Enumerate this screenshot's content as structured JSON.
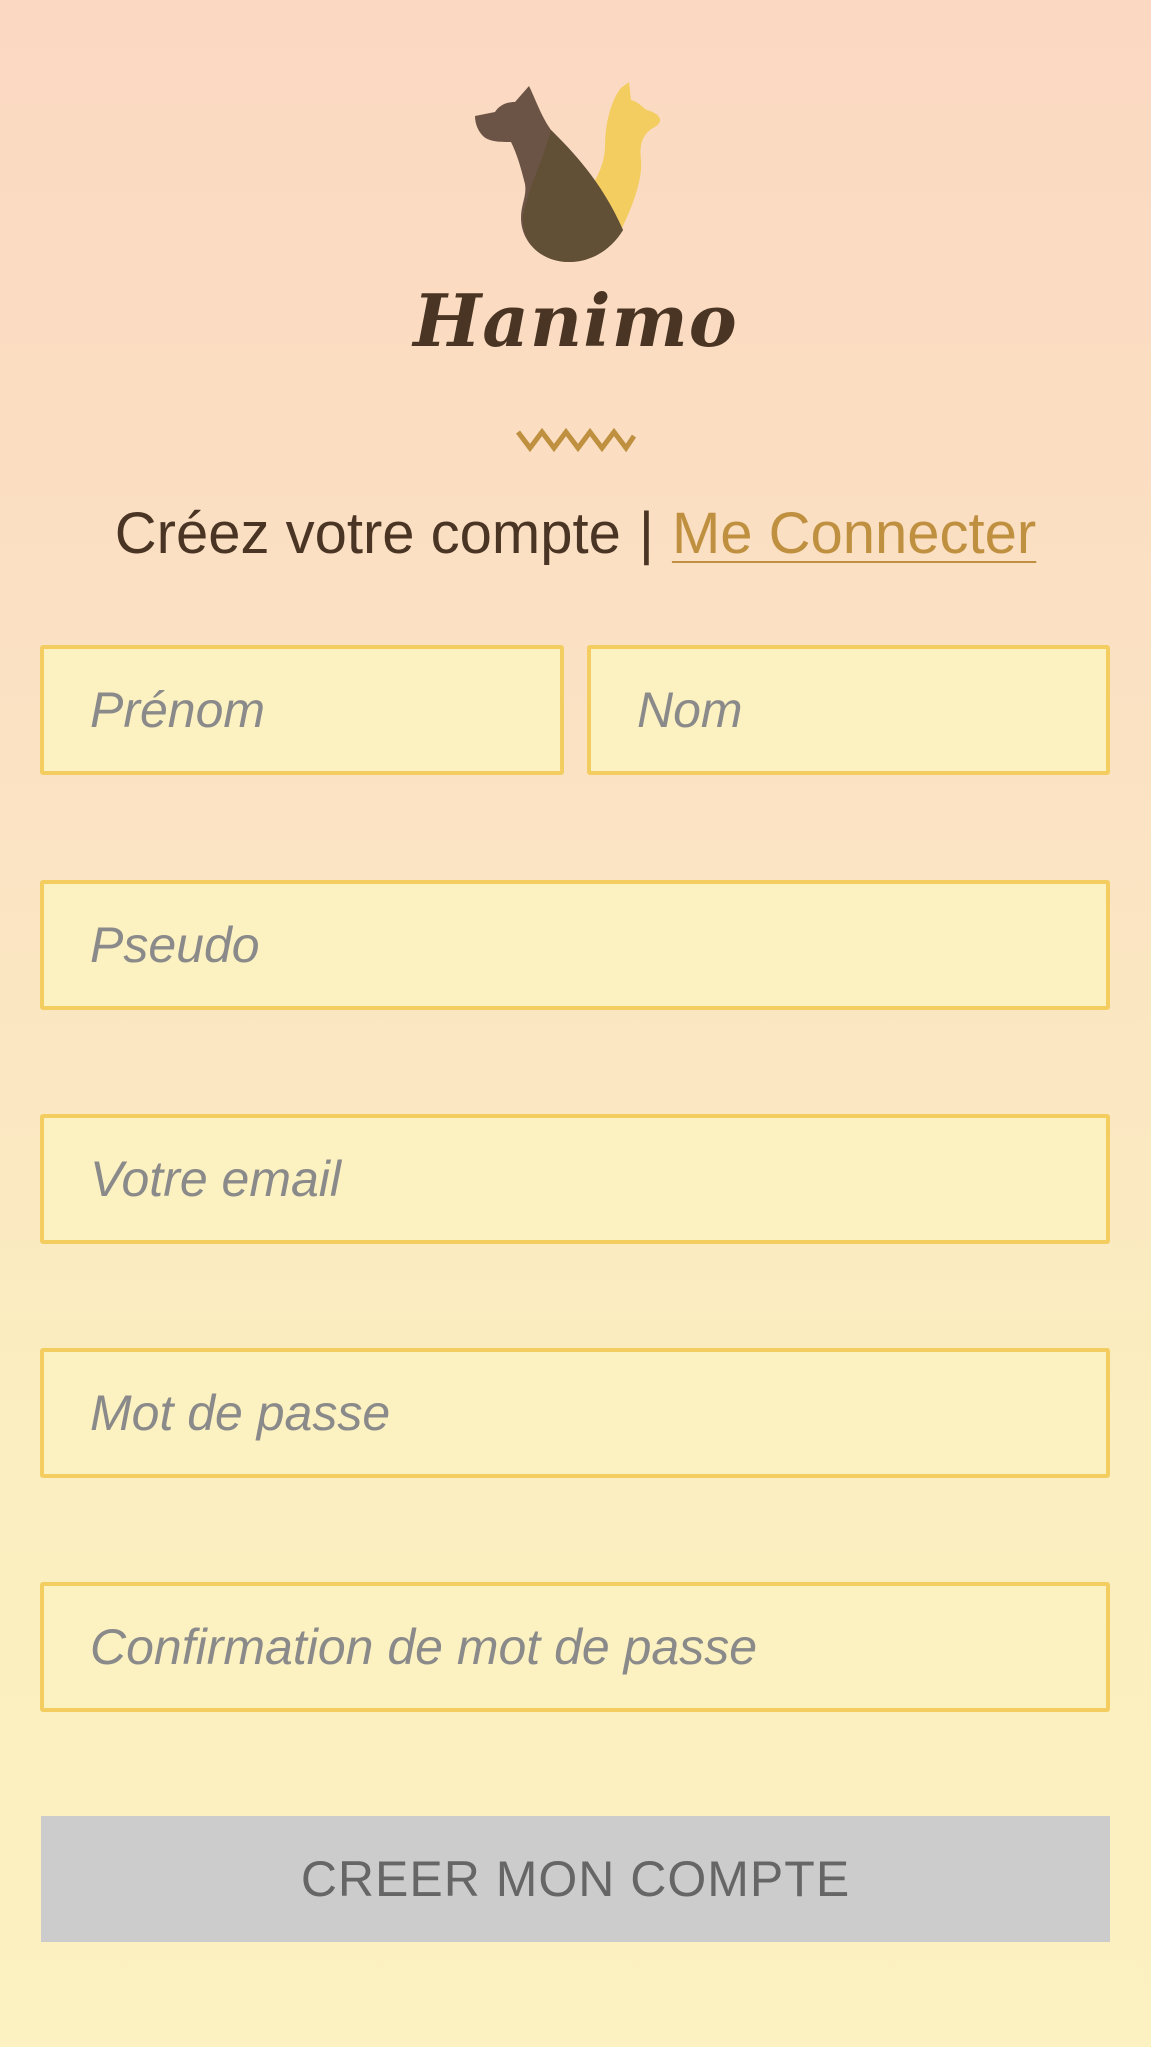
{
  "brand": {
    "name": "Hanimo",
    "logo_icon": "dog-cat-logo-icon",
    "colors": {
      "dark": "#4a3524",
      "accent": "#bf9040",
      "yellow": "#f3cd60"
    }
  },
  "header": {
    "title": "Créez votre compte",
    "separator": "|",
    "login_link": "Me Connecter"
  },
  "form": {
    "first_name": {
      "placeholder": "Prénom",
      "value": ""
    },
    "last_name": {
      "placeholder": "Nom",
      "value": ""
    },
    "username": {
      "placeholder": "Pseudo",
      "value": ""
    },
    "email": {
      "placeholder": "Votre email",
      "value": ""
    },
    "password": {
      "placeholder": "Mot de passe",
      "value": ""
    },
    "password_confirm": {
      "placeholder": "Confirmation de mot de passe",
      "value": ""
    },
    "submit_label": "CREER MON COMPTE"
  }
}
